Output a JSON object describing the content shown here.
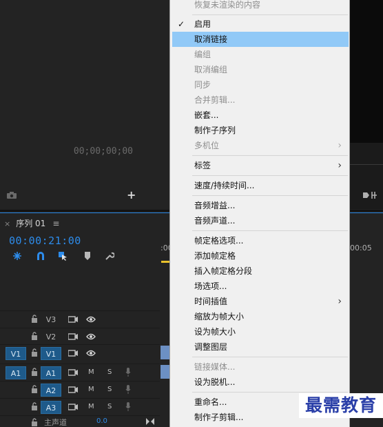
{
  "source_monitor": {
    "timecode": "00;00;00;00",
    "camera_icon": "camera-icon",
    "add_label": "+"
  },
  "sequence": {
    "close_label": "×",
    "tab_label": "序列 01",
    "menu_label": "≡",
    "timecode": "00:00:21:00",
    "ruler_left": ":00",
    "ruler_right": "00:05"
  },
  "tracks": [
    {
      "source": "",
      "name": "V3",
      "type": "video"
    },
    {
      "source": "",
      "name": "V2",
      "type": "video"
    },
    {
      "source": "V1",
      "name": "V1",
      "type": "video"
    },
    {
      "source": "A1",
      "name": "A1",
      "type": "audio"
    },
    {
      "source": "",
      "name": "A2",
      "type": "audio"
    },
    {
      "source": "",
      "name": "A3",
      "type": "audio"
    }
  ],
  "track_labels": {
    "mute": "M",
    "solo": "S"
  },
  "master": {
    "label": "主声道",
    "value": "0.0"
  },
  "context_menu": {
    "items": [
      {
        "label": "恢复未渲染的内容",
        "disabled": true
      },
      {
        "label": "启用",
        "checked": true
      },
      {
        "label": "取消链接",
        "highlighted": true
      },
      {
        "label": "编组",
        "disabled": true
      },
      {
        "label": "取消编组",
        "disabled": true
      },
      {
        "label": "同步",
        "disabled": true
      },
      {
        "label": "合并剪辑...",
        "disabled": true
      },
      {
        "label": "嵌套..."
      },
      {
        "label": "制作子序列"
      },
      {
        "label": "多机位",
        "disabled": true,
        "submenu": true
      },
      {
        "label": "标签",
        "submenu": true
      },
      {
        "label": "速度/持续时间..."
      },
      {
        "label": "音频增益..."
      },
      {
        "label": "音频声道..."
      },
      {
        "label": "帧定格选项..."
      },
      {
        "label": "添加帧定格"
      },
      {
        "label": "插入帧定格分段"
      },
      {
        "label": "场选项..."
      },
      {
        "label": "时间插值",
        "submenu": true
      },
      {
        "label": "缩放为帧大小"
      },
      {
        "label": "设为帧大小"
      },
      {
        "label": "调整图层"
      },
      {
        "label": "链接媒体...",
        "disabled": true
      },
      {
        "label": "设为脱机..."
      },
      {
        "label": "重命名..."
      },
      {
        "label": "制作子剪辑..."
      }
    ],
    "checkmark": "✓",
    "submenu_arrow": "›"
  },
  "watermark": {
    "text": "最需教育"
  },
  "colors": {
    "accent": "#2d8ceb",
    "highlight": "#91c9f7",
    "menu_bg": "#f0f0f0",
    "playhead": "#e8c12c"
  }
}
